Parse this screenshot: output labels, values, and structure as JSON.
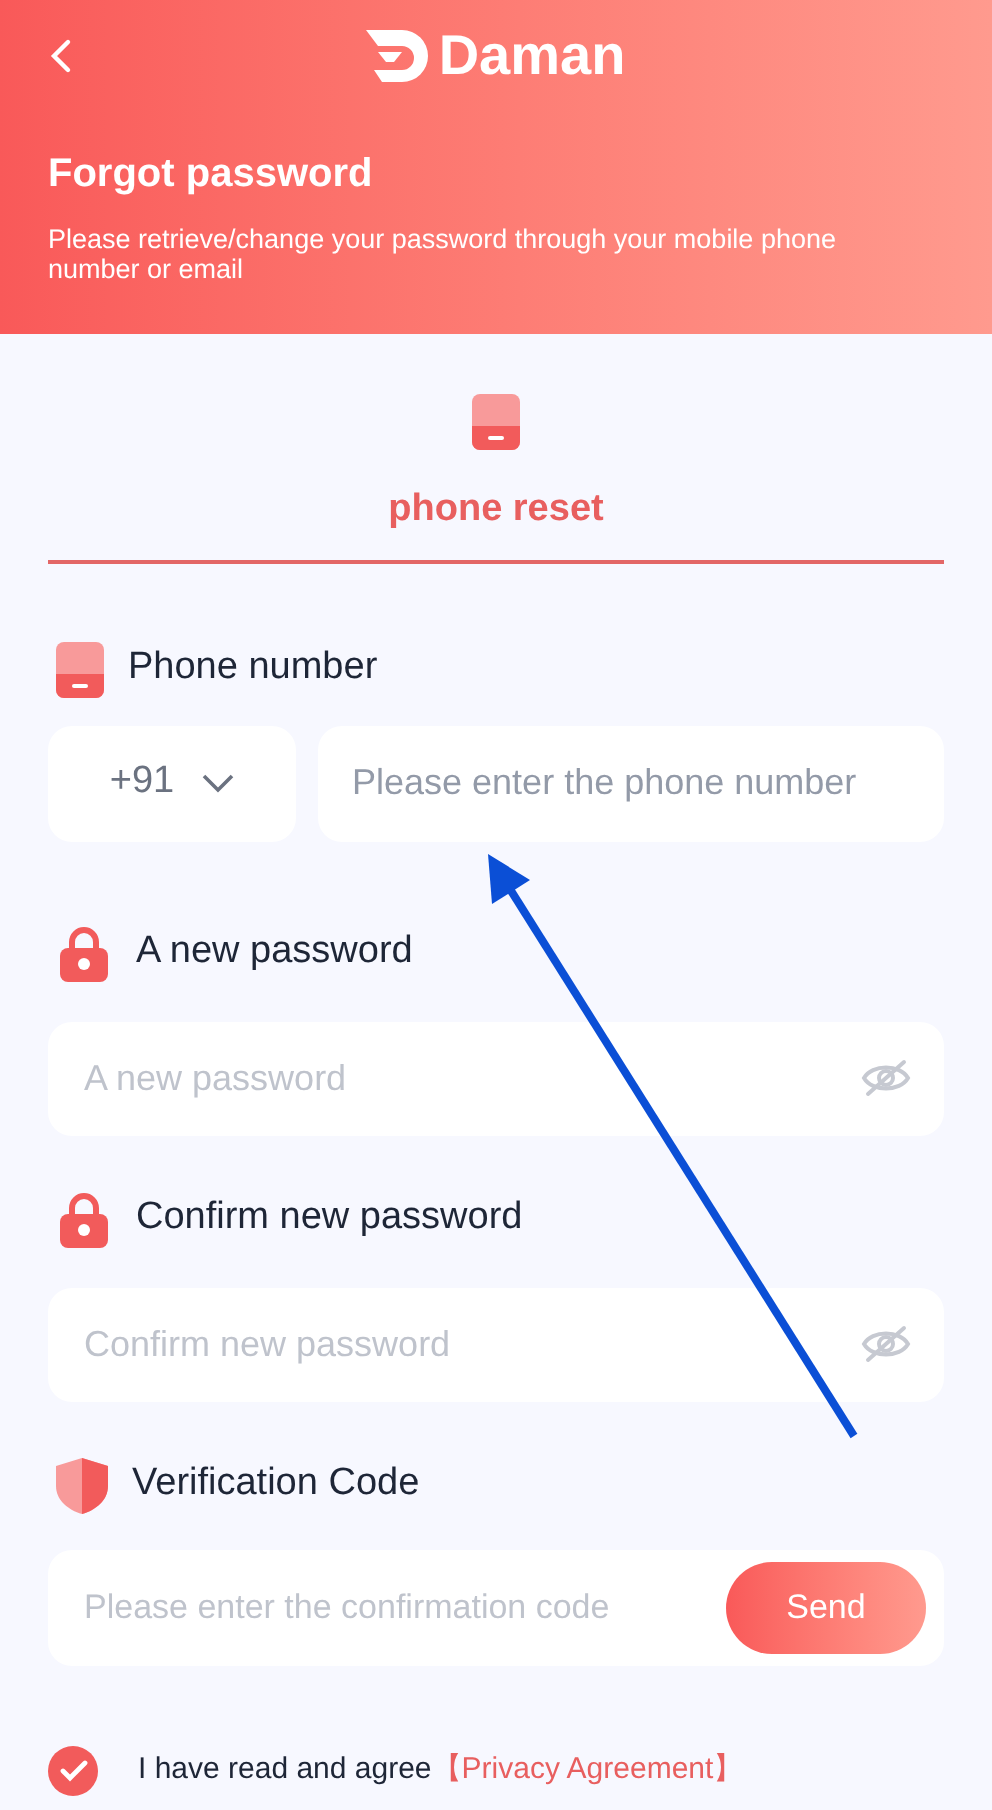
{
  "header": {
    "logo_text": "Daman",
    "title": "Forgot password",
    "subtitle": "Please retrieve/change your password through your mobile phone number or email"
  },
  "tabs": [
    {
      "label": "phone reset",
      "selected": true
    }
  ],
  "fields": [
    {
      "kind": "phone",
      "label": "Phone number",
      "country_code": "+91",
      "placeholder": "Please enter the phone number"
    },
    {
      "kind": "password",
      "label": "A new password",
      "placeholder": "A new password"
    },
    {
      "kind": "password",
      "label": "Confirm new password",
      "placeholder": "Confirm new password"
    },
    {
      "kind": "code",
      "label": "Verification Code",
      "placeholder": "Please enter the confirmation code",
      "button": "Send"
    }
  ],
  "agreement": {
    "checked": true,
    "text": "I have read and agree",
    "link": "【Privacy Agreement】"
  }
}
